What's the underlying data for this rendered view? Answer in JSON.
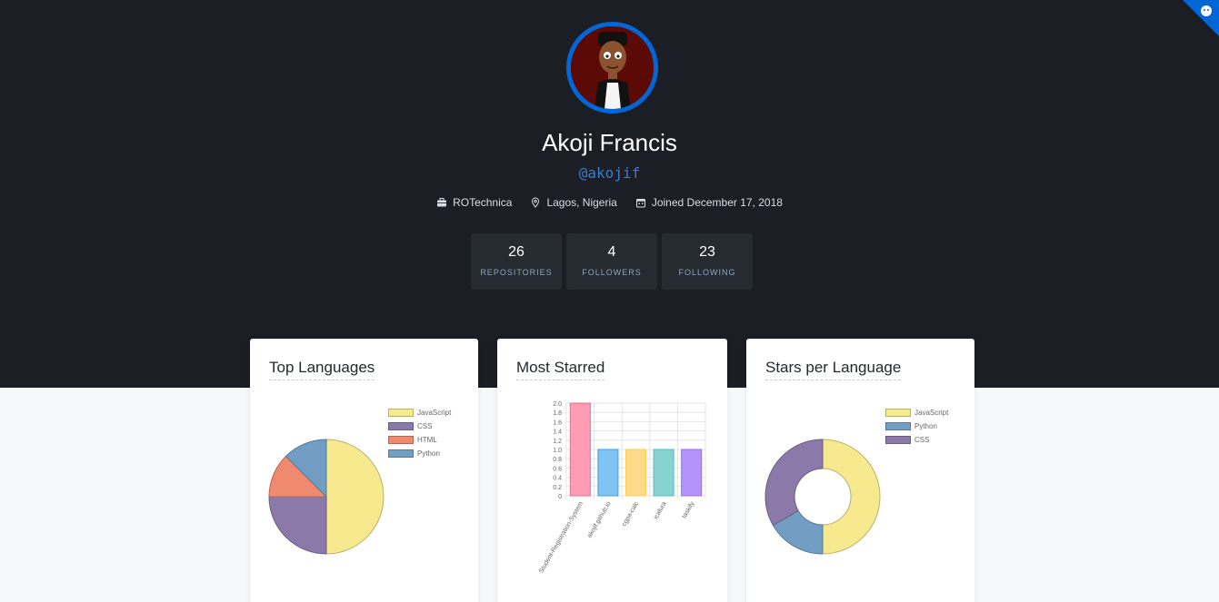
{
  "profile": {
    "name": "Akoji Francis",
    "handle": "@akojif",
    "company": "ROTechnica",
    "location": "Lagos, Nigeria",
    "joined": "Joined December 17, 2018"
  },
  "stats": [
    {
      "value": "26",
      "label": "REPOSITORIES"
    },
    {
      "value": "4",
      "label": "FOLLOWERS"
    },
    {
      "value": "23",
      "label": "FOLLOWING"
    }
  ],
  "cards": {
    "top_languages": {
      "title": "Top Languages"
    },
    "most_starred": {
      "title": "Most Starred"
    },
    "stars_per_language": {
      "title": "Stars per Language"
    }
  },
  "colors": {
    "hero_bg": "#1b1e25",
    "accent": "#0366d6",
    "yellow": "#f7e98e",
    "purple": "#8b7aa9",
    "salmon": "#ef8a6f",
    "blue": "#739ec4"
  },
  "chart_data": [
    {
      "type": "pie",
      "title": "Top Languages",
      "legend_position": "right",
      "labels": [
        "JavaScript",
        "CSS",
        "HTML",
        "Python"
      ],
      "values": [
        50,
        25,
        12.5,
        12.5
      ],
      "colors": [
        "#f7e98e",
        "#8b7aa9",
        "#ef8a6f",
        "#739ec4"
      ]
    },
    {
      "type": "bar",
      "title": "Most Starred",
      "categories": [
        "Student-Registration-System",
        "akojif.github.io",
        "cgpa-calc",
        "icafura",
        "taskify"
      ],
      "values": [
        2,
        1,
        1,
        1,
        1
      ],
      "ylim": [
        0,
        2
      ],
      "yticks": [
        "0",
        "0.2",
        "0.4",
        "0.6",
        "0.8",
        "1.0",
        "1.2",
        "1.4",
        "1.6",
        "1.8",
        "2.0"
      ],
      "grid": true,
      "colors": [
        "#ff9db4",
        "#7fc4f5",
        "#ffd98a",
        "#87d2d2",
        "#b593fb"
      ],
      "border_colors": [
        "#ff6384",
        "#36a2eb",
        "#ffce56",
        "#4bc0c0",
        "#9966ff"
      ]
    },
    {
      "type": "pie",
      "variant": "doughnut",
      "title": "Stars per Language",
      "legend_position": "right",
      "labels": [
        "JavaScript",
        "Python",
        "CSS"
      ],
      "values": [
        3,
        1,
        2
      ],
      "colors": [
        "#f7e98e",
        "#739ec4",
        "#8b7aa9"
      ]
    }
  ]
}
